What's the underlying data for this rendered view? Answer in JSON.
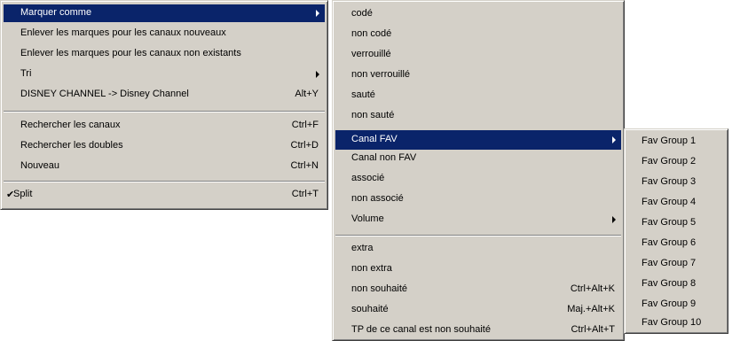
{
  "menu1": {
    "items": [
      {
        "label": "Marquer comme"
      },
      {
        "label": "Enlever les marques pour les canaux nouveaux"
      },
      {
        "label": "Enlever les marques pour les canaux non existants"
      },
      {
        "label": "Tri"
      },
      {
        "label": "DISNEY CHANNEL -> Disney Channel",
        "shortcut": "Alt+Y"
      },
      {
        "label": "Rechercher les canaux",
        "shortcut": "Ctrl+F"
      },
      {
        "label": "Rechercher les doubles",
        "shortcut": "Ctrl+D"
      },
      {
        "label": "Nouveau",
        "shortcut": "Ctrl+N"
      },
      {
        "label": "Split",
        "shortcut": "Ctrl+T",
        "check": "✔"
      }
    ]
  },
  "menu2": {
    "items": [
      {
        "label": "codé"
      },
      {
        "label": "non codé"
      },
      {
        "label": "verrouillé"
      },
      {
        "label": "non verrouillé"
      },
      {
        "label": "sauté"
      },
      {
        "label": "non sauté"
      },
      {
        "label": "Canal FAV"
      },
      {
        "label": "Canal non FAV"
      },
      {
        "label": "associé"
      },
      {
        "label": "non associé"
      },
      {
        "label": "Volume"
      },
      {
        "label": "extra"
      },
      {
        "label": "non extra"
      },
      {
        "label": "non souhaité",
        "shortcut": "Ctrl+Alt+K"
      },
      {
        "label": "souhaité",
        "shortcut": "Maj.+Alt+K"
      },
      {
        "label": "TP de ce canal est non souhaité",
        "shortcut": "Ctrl+Alt+T"
      }
    ]
  },
  "menu3": {
    "items": [
      {
        "label": "Fav Group 1"
      },
      {
        "label": "Fav Group 2"
      },
      {
        "label": "Fav Group 3"
      },
      {
        "label": "Fav Group 4"
      },
      {
        "label": "Fav Group 5"
      },
      {
        "label": "Fav Group 6"
      },
      {
        "label": "Fav Group 7"
      },
      {
        "label": "Fav Group 8"
      },
      {
        "label": "Fav Group 9"
      },
      {
        "label": "Fav Group 10"
      }
    ]
  },
  "colors": {
    "menu_bg": "#d4d0c8",
    "highlight": "#0a246a",
    "highlight_text": "#ffffff"
  },
  "icons": {
    "submenu": "submenu-arrow-icon",
    "check": "checkmark-icon"
  }
}
